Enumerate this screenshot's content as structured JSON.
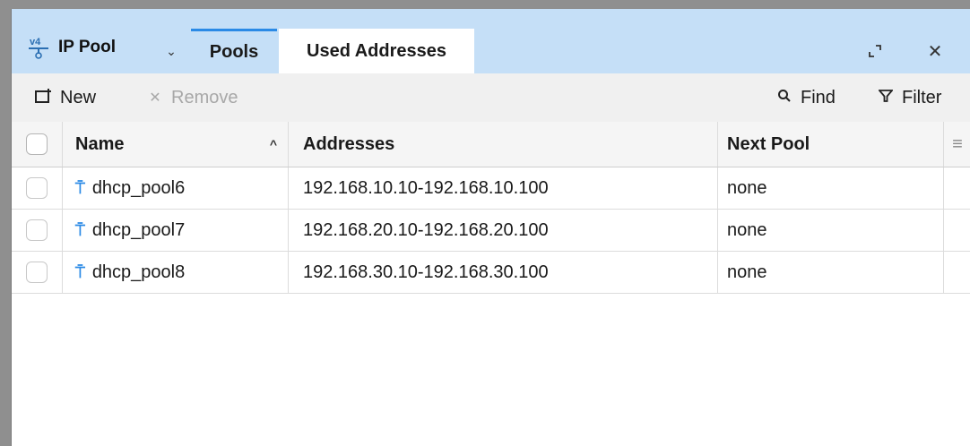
{
  "window": {
    "title": "IP Pool",
    "app_icon": "ipv4-pool-icon",
    "expand_icon": "expand-icon",
    "close_icon": "close-icon"
  },
  "tabs": [
    {
      "label": "Pools",
      "active": true
    },
    {
      "label": "Used Addresses",
      "active": false
    }
  ],
  "toolbar": {
    "new_label": "New",
    "remove_label": "Remove",
    "find_label": "Find",
    "filter_label": "Filter"
  },
  "table": {
    "columns": [
      "Name",
      "Addresses",
      "Next Pool"
    ],
    "sort_column": "Name",
    "sort_direction": "ascending",
    "rows": [
      {
        "name": "dhcp_pool6",
        "addresses": "192.168.10.10-192.168.10.100",
        "next_pool": "none"
      },
      {
        "name": "dhcp_pool7",
        "addresses": "192.168.20.10-192.168.20.100",
        "next_pool": "none"
      },
      {
        "name": "dhcp_pool8",
        "addresses": "192.168.30.10-192.168.30.100",
        "next_pool": "none"
      }
    ]
  },
  "colors": {
    "accent": "#2b8ae6",
    "titlebar": "#c5dff7"
  }
}
